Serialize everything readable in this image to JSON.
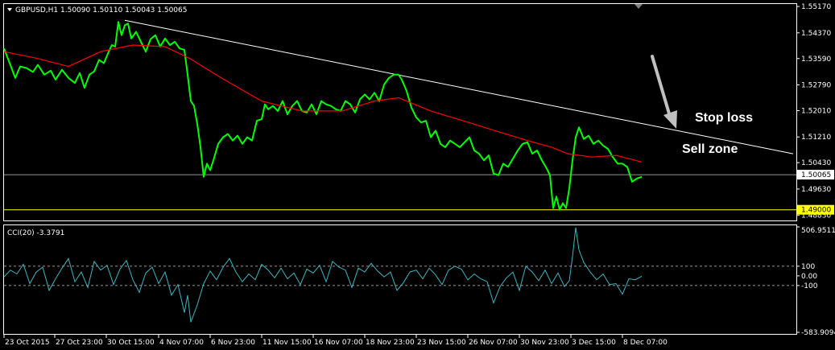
{
  "window": {
    "symbol_header": "GBPUSD,H1  1.50090 1.50110 1.50043 1.50065",
    "cci_header": "CCI(20) -3.3791"
  },
  "chart_data": [
    {
      "type": "line",
      "title": "GBPUSD,H1",
      "ohlc_header": {
        "open": 1.5009,
        "high": 1.5011,
        "low": 1.50043,
        "close": 1.50065
      },
      "y_ticks": [
        "1.55170",
        "1.54370",
        "1.53590",
        "1.52790",
        "1.52010",
        "1.51210",
        "1.50430",
        "1.49630",
        "1.48830"
      ],
      "ylim": [
        1.487,
        1.5522
      ],
      "current_price": "1.50065",
      "support_level": "1.49000",
      "x_ticks": [
        "23 Oct 2015",
        "27 Oct 23:00",
        "30 Oct 15:00",
        "4 Nov 07:00",
        "6 Nov 23:00",
        "11 Nov 15:00",
        "16 Nov 07:00",
        "18 Nov 23:00",
        "23 Nov 15:00",
        "26 Nov 07:00",
        "30 Nov 23:00",
        "3 Dec 15:00",
        "8 Dec 07:00"
      ],
      "series": [
        {
          "color": "#00ff00",
          "x": [
            0,
            7,
            14,
            20,
            28,
            36,
            42,
            50,
            58,
            64,
            72,
            80,
            88,
            94,
            100,
            106,
            112,
            118,
            124,
            130,
            134,
            138,
            142,
            146,
            150,
            154,
            158,
            164,
            170,
            176,
            182,
            188,
            194,
            200,
            206,
            212,
            218,
            224,
            228,
            232,
            236,
            240,
            244,
            248,
            252,
            256,
            260,
            266,
            272,
            278,
            284,
            290,
            296,
            302,
            308,
            314,
            320,
            324,
            328,
            334,
            340,
            346,
            352,
            358,
            364,
            370,
            376,
            382,
            388,
            394,
            400,
            406,
            412,
            418,
            424,
            430,
            436,
            442,
            448,
            454,
            460,
            466,
            472,
            478,
            484,
            490,
            494,
            500,
            506,
            512,
            518,
            524,
            530,
            536,
            542,
            548,
            554,
            560,
            566,
            572,
            578,
            584,
            590,
            596,
            602,
            608,
            614,
            620,
            626,
            632,
            638,
            644,
            650,
            656,
            662,
            668,
            674,
            678,
            682,
            686,
            690,
            694,
            698,
            702,
            706,
            710,
            714,
            720,
            726,
            732,
            738,
            744,
            750,
            756,
            762,
            768,
            774,
            780,
            786,
            792
          ],
          "values": [
            1.539,
            1.5345,
            1.53,
            1.5335,
            1.533,
            1.5318,
            1.534,
            1.531,
            1.5322,
            1.5295,
            1.5325,
            1.53,
            1.5285,
            1.5315,
            1.527,
            1.531,
            1.532,
            1.5355,
            1.5345,
            1.538,
            1.54,
            1.5395,
            1.547,
            1.543,
            1.546,
            1.5465,
            1.542,
            1.544,
            1.541,
            1.538,
            1.5418,
            1.543,
            1.5395,
            1.542,
            1.54,
            1.541,
            1.539,
            1.5385,
            1.531,
            1.523,
            1.5215,
            1.516,
            1.509,
            1.5,
            1.504,
            1.502,
            1.505,
            1.51,
            1.512,
            1.513,
            1.511,
            1.5125,
            1.51,
            1.512,
            1.511,
            1.517,
            1.5175,
            1.522,
            1.5205,
            1.5215,
            1.52,
            1.523,
            1.519,
            1.5215,
            1.523,
            1.52,
            1.5195,
            1.522,
            1.519,
            1.523,
            1.522,
            1.5215,
            1.5205,
            1.52,
            1.523,
            1.522,
            1.5195,
            1.5235,
            1.525,
            1.5235,
            1.5255,
            1.523,
            1.528,
            1.53,
            1.531,
            1.531,
            1.5295,
            1.526,
            1.521,
            1.518,
            1.5165,
            1.517,
            1.512,
            1.514,
            1.51,
            1.509,
            1.511,
            1.51,
            1.509,
            1.5105,
            1.512,
            1.508,
            1.507,
            1.505,
            1.5065,
            1.501,
            1.5005,
            1.504,
            1.503,
            1.5055,
            1.508,
            1.51,
            1.5105,
            1.507,
            1.508,
            1.505,
            1.5025,
            1.5005,
            1.4905,
            1.494,
            1.49,
            1.492,
            1.4905,
            1.4965,
            1.505,
            1.512,
            1.515,
            1.5115,
            1.5125,
            1.51,
            1.511,
            1.5095,
            1.5085,
            1.506,
            1.504,
            1.504,
            1.503,
            1.4985,
            1.4995,
            1.5
          ]
        },
        {
          "color": "#ff0000",
          "x": [
            0,
            40,
            80,
            120,
            160,
            200,
            230,
            270,
            320,
            370,
            420,
            460,
            490,
            530,
            570,
            610,
            650,
            680,
            700,
            730,
            760,
            792
          ],
          "values": [
            1.538,
            1.536,
            1.5335,
            1.538,
            1.54,
            1.5395,
            1.536,
            1.53,
            1.523,
            1.52,
            1.52,
            1.523,
            1.524,
            1.52,
            1.517,
            1.514,
            1.511,
            1.509,
            1.507,
            1.506,
            1.5065,
            1.5045
          ]
        }
      ],
      "trendline": {
        "x": [
          150,
          980
        ],
        "values": [
          1.5475,
          1.507
        ],
        "color": "#ffffff"
      }
    },
    {
      "type": "line",
      "title": "CCI(20)",
      "current_value": -3.3791,
      "ylim": [
        -583.9094,
        506.9511
      ],
      "levels": [
        100,
        -100
      ],
      "y_ticks": [
        "506.9511",
        "100",
        "0.00",
        "-100",
        "-583.9094"
      ],
      "series": [
        {
          "name": "CCI(20)",
          "color": "#3fb6c0",
          "x": [
            0,
            8,
            16,
            24,
            32,
            40,
            48,
            56,
            64,
            72,
            80,
            88,
            96,
            104,
            112,
            120,
            128,
            136,
            144,
            152,
            160,
            168,
            176,
            184,
            192,
            200,
            208,
            216,
            224,
            228,
            232,
            240,
            248,
            256,
            264,
            272,
            280,
            288,
            296,
            304,
            312,
            320,
            328,
            336,
            344,
            352,
            360,
            368,
            376,
            384,
            392,
            400,
            408,
            416,
            424,
            432,
            440,
            448,
            456,
            464,
            472,
            480,
            488,
            496,
            504,
            512,
            520,
            528,
            536,
            544,
            552,
            560,
            568,
            576,
            584,
            592,
            600,
            608,
            616,
            624,
            632,
            640,
            648,
            656,
            664,
            672,
            680,
            688,
            696,
            702,
            706,
            710,
            714,
            720,
            728,
            736,
            744,
            752,
            760,
            768,
            776,
            784,
            792
          ],
          "values": [
            -10,
            60,
            20,
            120,
            -80,
            40,
            90,
            -150,
            -30,
            80,
            180,
            -60,
            40,
            -120,
            150,
            60,
            110,
            -90,
            70,
            160,
            -40,
            -170,
            30,
            90,
            -80,
            40,
            -200,
            -90,
            -380,
            -200,
            -480,
            -300,
            -80,
            50,
            -40,
            90,
            180,
            40,
            -60,
            20,
            -40,
            120,
            60,
            -20,
            80,
            -30,
            30,
            -90,
            70,
            30,
            110,
            -60,
            150,
            90,
            60,
            -120,
            80,
            40,
            130,
            50,
            -10,
            40,
            -150,
            -70,
            40,
            60,
            -30,
            80,
            10,
            -90,
            60,
            100,
            70,
            -40,
            20,
            -30,
            -60,
            -280,
            -110,
            -20,
            40,
            -150,
            100,
            40,
            -50,
            60,
            -80,
            30,
            -110,
            -50,
            200,
            500,
            270,
            140,
            40,
            -40,
            20,
            -90,
            -80,
            -190,
            -30,
            -40,
            -3.38
          ]
        }
      ]
    }
  ],
  "annotations": {
    "stop_loss": "Stop loss",
    "sell_zone": "Sell zone"
  },
  "colors": {
    "background": "#000000",
    "frame": "#ffffff",
    "price_line": "#00ff00",
    "moving_average": "#ff0000",
    "cci": "#3fb6c0",
    "support_line": "#ffff00",
    "support_label_bg": "#ffff00",
    "current_price_label_bg": "#ffffff",
    "arrow": "#c0c0c0"
  }
}
